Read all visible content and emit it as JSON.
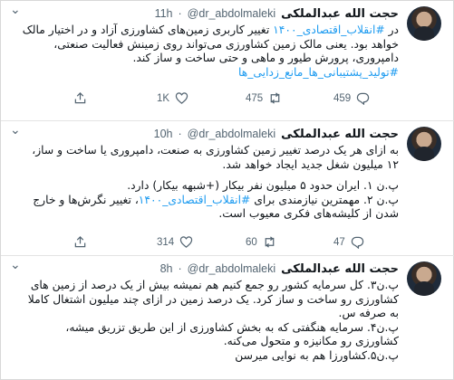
{
  "tweets": [
    {
      "name": "حجت الله عبدالملکی",
      "handle": "@dr_abdolmaleki",
      "sep": "·",
      "time": "11h",
      "lines": [
        [
          "در ",
          "#انقلاب_اقتصادی_۱۴۰۰",
          " تغییر کاربری زمین‌های کشاورزی آزاد و در اختیار مالک"
        ],
        [
          "خواهد بود. یعنی مالک زمین کشاورزی می‌تواند روی زمینش فعالیت صنعتی،"
        ],
        [
          "دامپروری، پرورش طیور و ماهی و حتی ساخت و ساز کند."
        ],
        [
          "",
          "#تولید_پشتیبانی_ها_مانع_زدایی_ها"
        ]
      ],
      "replies": "459",
      "retweets": "475",
      "likes": "1K"
    },
    {
      "name": "حجت الله عبدالملکی",
      "handle": "@dr_abdolmaleki",
      "sep": "·",
      "time": "10h",
      "lines": [
        [
          "به ازای هر یک درصد تغییر زمین کشاورزی به صنعت، دامپروری یا ساخت و ساز،"
        ],
        [
          "۱۲ میلیون شغل جدید ایجاد خواهد شد."
        ],
        [
          ""
        ],
        [
          "پ.ن ۱. ایران حدود ۵ میلیون نفر بیکار (+شبهه بیکار) دارد."
        ],
        [
          "پ.ن ۲. مهمترین نیازمندی برای ",
          "#انقلاب_اقتصادی_۱۴۰۰",
          "، تغییر نگرش‌ها و خارج"
        ],
        [
          "شدن از کلیشه‌های فکری معیوب است."
        ]
      ],
      "replies": "47",
      "retweets": "60",
      "likes": "314"
    },
    {
      "name": "حجت الله عبدالملکی",
      "handle": "@dr_abdolmaleki",
      "sep": "·",
      "time": "8h",
      "lines": [
        [
          "پ.ن۳. کل سرمایه کشور رو جمع کنیم هم نمیشه بیش از یک درصد از زمین های"
        ],
        [
          "کشاورزی رو ساخت و ساز کرد. یک درصد زمین در ازای چند میلیون اشتغال کاملا"
        ],
        [
          "به صرفه س."
        ],
        [
          "پ.ن۴. سرمایه هنگفتی که به بخش کشاورزی از این طریق تزریق میشه،"
        ],
        [
          "کشاورزی رو مکانیزه و متحول می‌کنه."
        ],
        [
          "پ.ن۵.کشاورزا هم به نوایی میرسن"
        ]
      ]
    }
  ],
  "icons": {
    "reply": "reply-icon",
    "retweet": "retweet-icon",
    "like": "heart-icon",
    "share": "share-icon",
    "more": "chevron-down-icon"
  },
  "colors": {
    "link": "#1d9bf0",
    "muted": "#536471",
    "text": "#0f1419"
  }
}
